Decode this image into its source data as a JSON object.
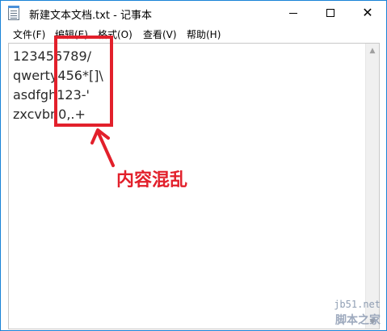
{
  "window": {
    "title": "新建文本文档.txt - 记事本"
  },
  "menu": {
    "file": "文件(F)",
    "edit": "编辑(E)",
    "format": "格式(O)",
    "view": "查看(V)",
    "help": "帮助(H)"
  },
  "editor": {
    "content": "123456789/\nqwerty456*[]\\\nasdfgh123-'\nzxcvbn0,.+"
  },
  "annotation": {
    "label": "内容混乱",
    "color": "#e2202b"
  },
  "watermark": {
    "url": "jb51.net",
    "name": "脚本之家"
  },
  "colors": {
    "window_border": "#1883d7",
    "text": "#2a2a2a"
  }
}
